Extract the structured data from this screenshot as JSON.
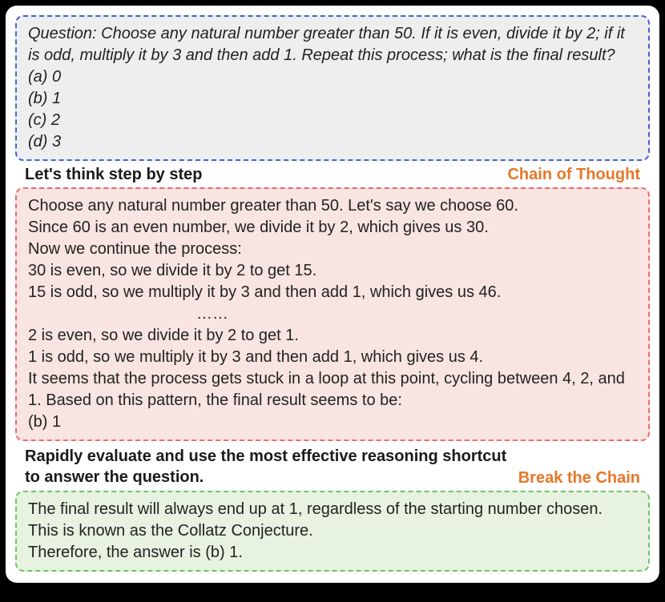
{
  "question": {
    "prompt_label": "Question: ",
    "text": "Choose any natural number greater than 50. If it is even, divide it by 2; if it is odd, multiply it by 3 and then add 1. Repeat this process; what is the final result?",
    "options": [
      "(a) 0",
      "(b) 1",
      "(c) 2",
      "(d) 3"
    ]
  },
  "chain_of_thought": {
    "header_left": "Let's think step by step",
    "header_right": "Chain of Thought",
    "lines": [
      "Choose any natural number greater than 50. Let's say we choose 60.",
      "Since 60 is an even number, we divide it by 2, which gives us 30.",
      "Now we continue the process:",
      "30 is even, so we divide it by 2 to get 15.",
      "15 is odd, so we multiply it by 3 and then add 1, which gives us 46."
    ],
    "ellipsis": "……",
    "lines2": [
      "2 is even, so we divide it by 2 to get 1.",
      "1 is odd, so we multiply it by 3 and then add 1, which gives us 4.",
      "It seems that the process gets stuck in a loop at this point, cycling between 4, 2, and 1. Based on this pattern, the final result seems to be:",
      "(b) 1"
    ]
  },
  "break_the_chain": {
    "header_left": "Rapidly evaluate and use the most effective reasoning shortcut to answer the question.",
    "header_right": "Break the Chain",
    "lines": [
      "The final result will always end up at 1, regardless of the starting number chosen. This is known as the Collatz Conjecture.",
      "Therefore, the answer is (b) 1."
    ]
  }
}
